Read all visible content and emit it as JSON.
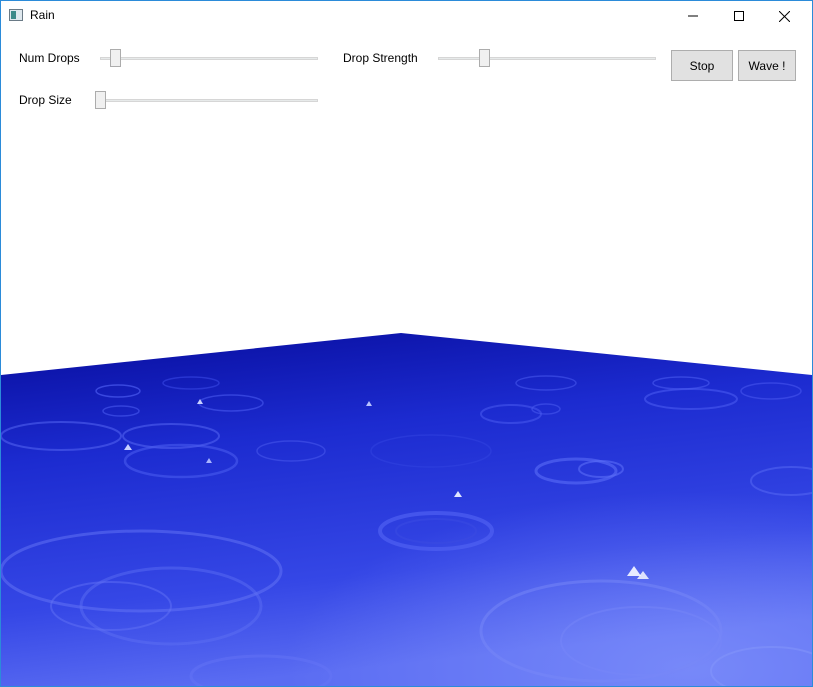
{
  "window": {
    "title": "Rain",
    "border_color": "#2b8bd9"
  },
  "title_bar": {
    "icon": "app-window-icon",
    "buttons": [
      "minimize-icon",
      "maximize-icon",
      "close-icon"
    ]
  },
  "controls": {
    "num_drops": {
      "label": "Num Drops",
      "value_fraction": 0.05
    },
    "drop_strength": {
      "label": "Drop Strength",
      "value_fraction": 0.2
    },
    "drop_size": {
      "label": "Drop Size",
      "value_fraction": 0.0
    },
    "stop_button": {
      "label": "Stop"
    },
    "wave_button": {
      "label": "Wave !"
    }
  },
  "scene": {
    "description_colors": {
      "water_far": "#0a10a8",
      "water_near": "#5a6cf2",
      "background": "#ffffff"
    }
  }
}
